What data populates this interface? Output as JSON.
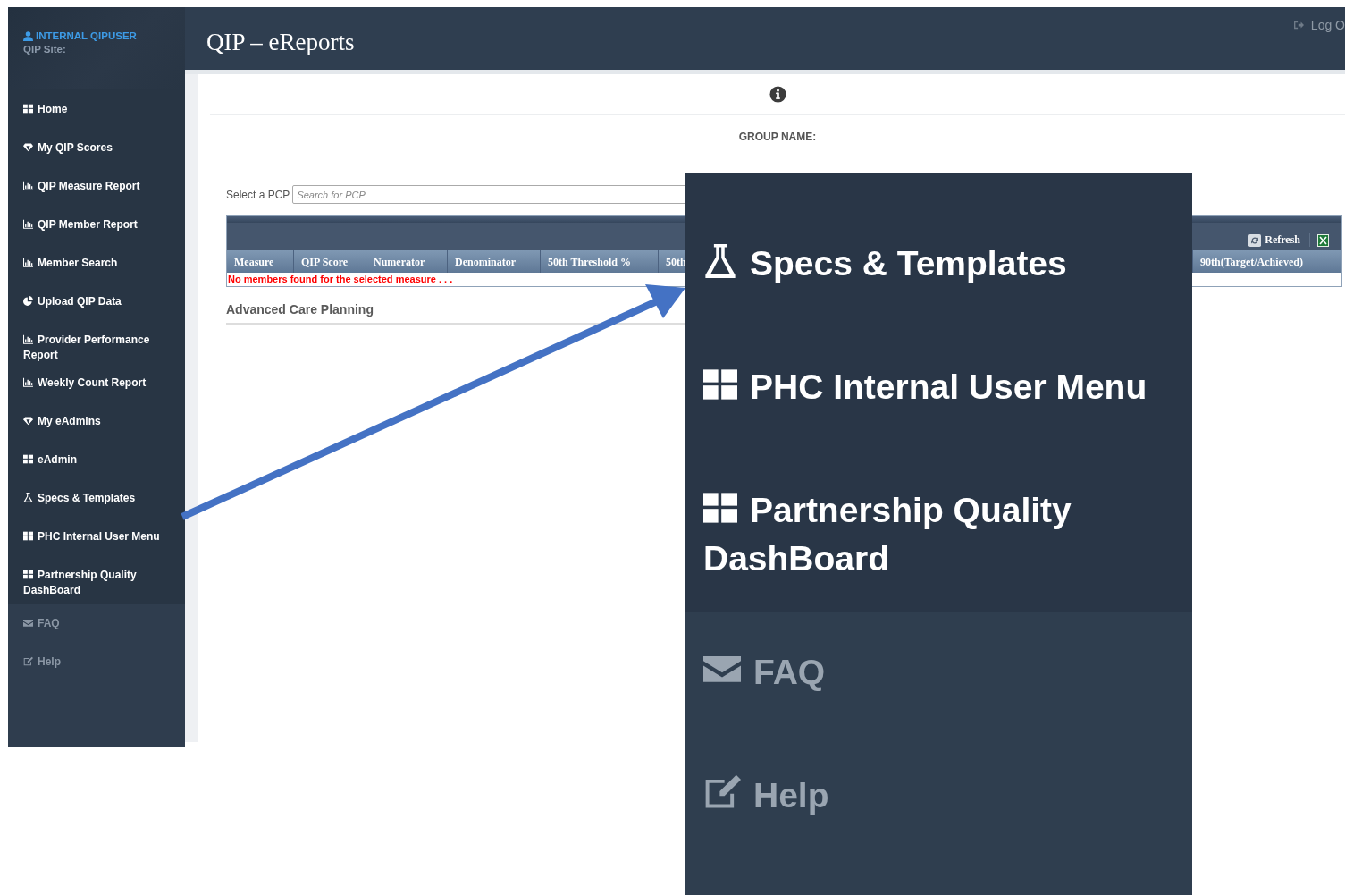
{
  "sidebar": {
    "user": "INTERNAL QIPUSER",
    "site_label": "QIP Site:",
    "items": [
      {
        "label": "Home",
        "kind": "grid"
      },
      {
        "label": "My QIP Scores",
        "kind": "gem"
      },
      {
        "label": "QIP Measure Report",
        "kind": "chart"
      },
      {
        "label": "QIP Member Report",
        "kind": "chart"
      },
      {
        "label": "Member Search",
        "kind": "chart"
      },
      {
        "label": "Upload QIP Data",
        "kind": "pie"
      },
      {
        "label": "Provider Performance Report",
        "kind": "chart"
      },
      {
        "label": "Weekly Count Report",
        "kind": "chart"
      },
      {
        "label": "My eAdmins",
        "kind": "gem"
      },
      {
        "label": "eAdmin",
        "kind": "grid"
      },
      {
        "label": "Specs & Templates",
        "kind": "flask"
      },
      {
        "label": "PHC Internal User Menu",
        "kind": "grid"
      },
      {
        "label": "Partnership Quality DashBoard",
        "kind": "grid"
      }
    ],
    "footer_items": [
      {
        "label": "FAQ",
        "kind": "mail"
      },
      {
        "label": "Help",
        "kind": "edit"
      }
    ]
  },
  "header": {
    "title": "QIP – eReports",
    "logout": "Log O"
  },
  "content": {
    "group_label": "GROUP NAME:",
    "pcp_label": "Select a PCP",
    "pcp_search": {
      "placeholder": "Search for PCP"
    },
    "table": {
      "refresh": "Refresh",
      "columns": [
        "Measure",
        "QIP Score",
        "Numerator",
        "Denominator",
        "50th Threshold %",
        "50th",
        "90th(Target/Achieved)"
      ],
      "message": "No members found for the selected measure . . ."
    },
    "section_title": "Advanced Care Planning"
  },
  "callout": {
    "items": [
      {
        "label": "Specs & Templates",
        "kind": "flask"
      },
      {
        "label": "PHC Internal User Menu",
        "kind": "grid"
      },
      {
        "label": "Partnership Quality DashBoard",
        "kind": "grid"
      }
    ],
    "footer_items": [
      {
        "label": "FAQ",
        "kind": "mail"
      },
      {
        "label": "Help",
        "kind": "edit"
      }
    ]
  }
}
